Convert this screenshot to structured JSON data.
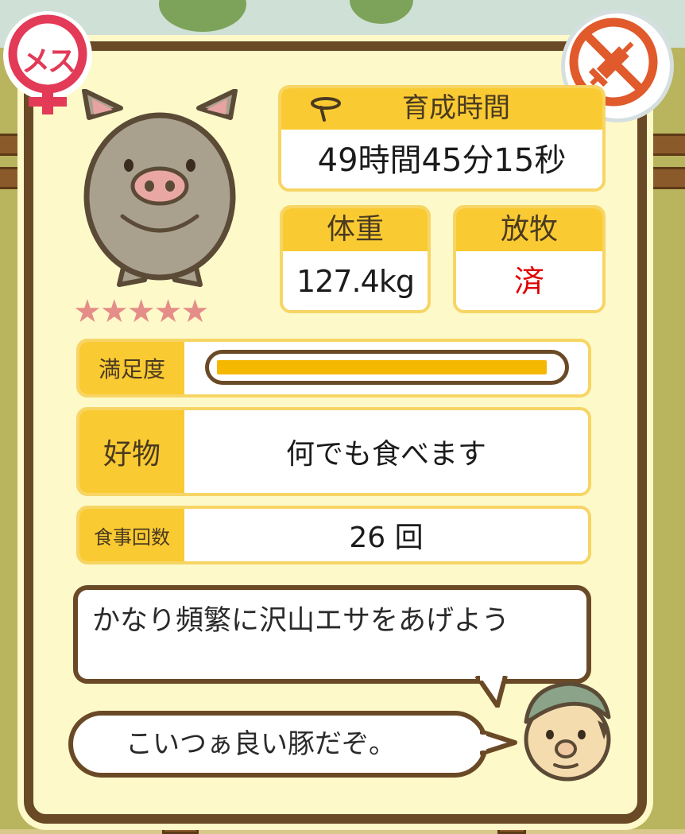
{
  "colors": {
    "card_bg": "#fdf9c9",
    "card_border": "#6a4a26",
    "label_yellow": "#f9ca32",
    "graze_value": "#e00000",
    "star": "#e58d88",
    "female_badge": "#e23a57",
    "vaccine_badge": "#e05a2c"
  },
  "badges": {
    "sex_label": "メス",
    "sex_icon": "female-icon",
    "vaccine_icon": "no-syringe-icon"
  },
  "pig": {
    "stars": "★★★★★",
    "rating": 5
  },
  "growth_time": {
    "label": "育成時間",
    "icon": "watering-can-icon",
    "value": "49時間45分15秒"
  },
  "weight": {
    "label": "体重",
    "value": "127.4kg"
  },
  "grazing": {
    "label": "放牧",
    "value": "済"
  },
  "satisfaction": {
    "label": "満足度",
    "level": 0.97
  },
  "favorite": {
    "label": "好物",
    "value": "何でも食べます"
  },
  "meals": {
    "label": "食事回数",
    "value": "26 回"
  },
  "advice": {
    "message": "かなり頻繁に沢山エサをあげよう",
    "comment": "こいつぁ良い豚だぞ。"
  }
}
